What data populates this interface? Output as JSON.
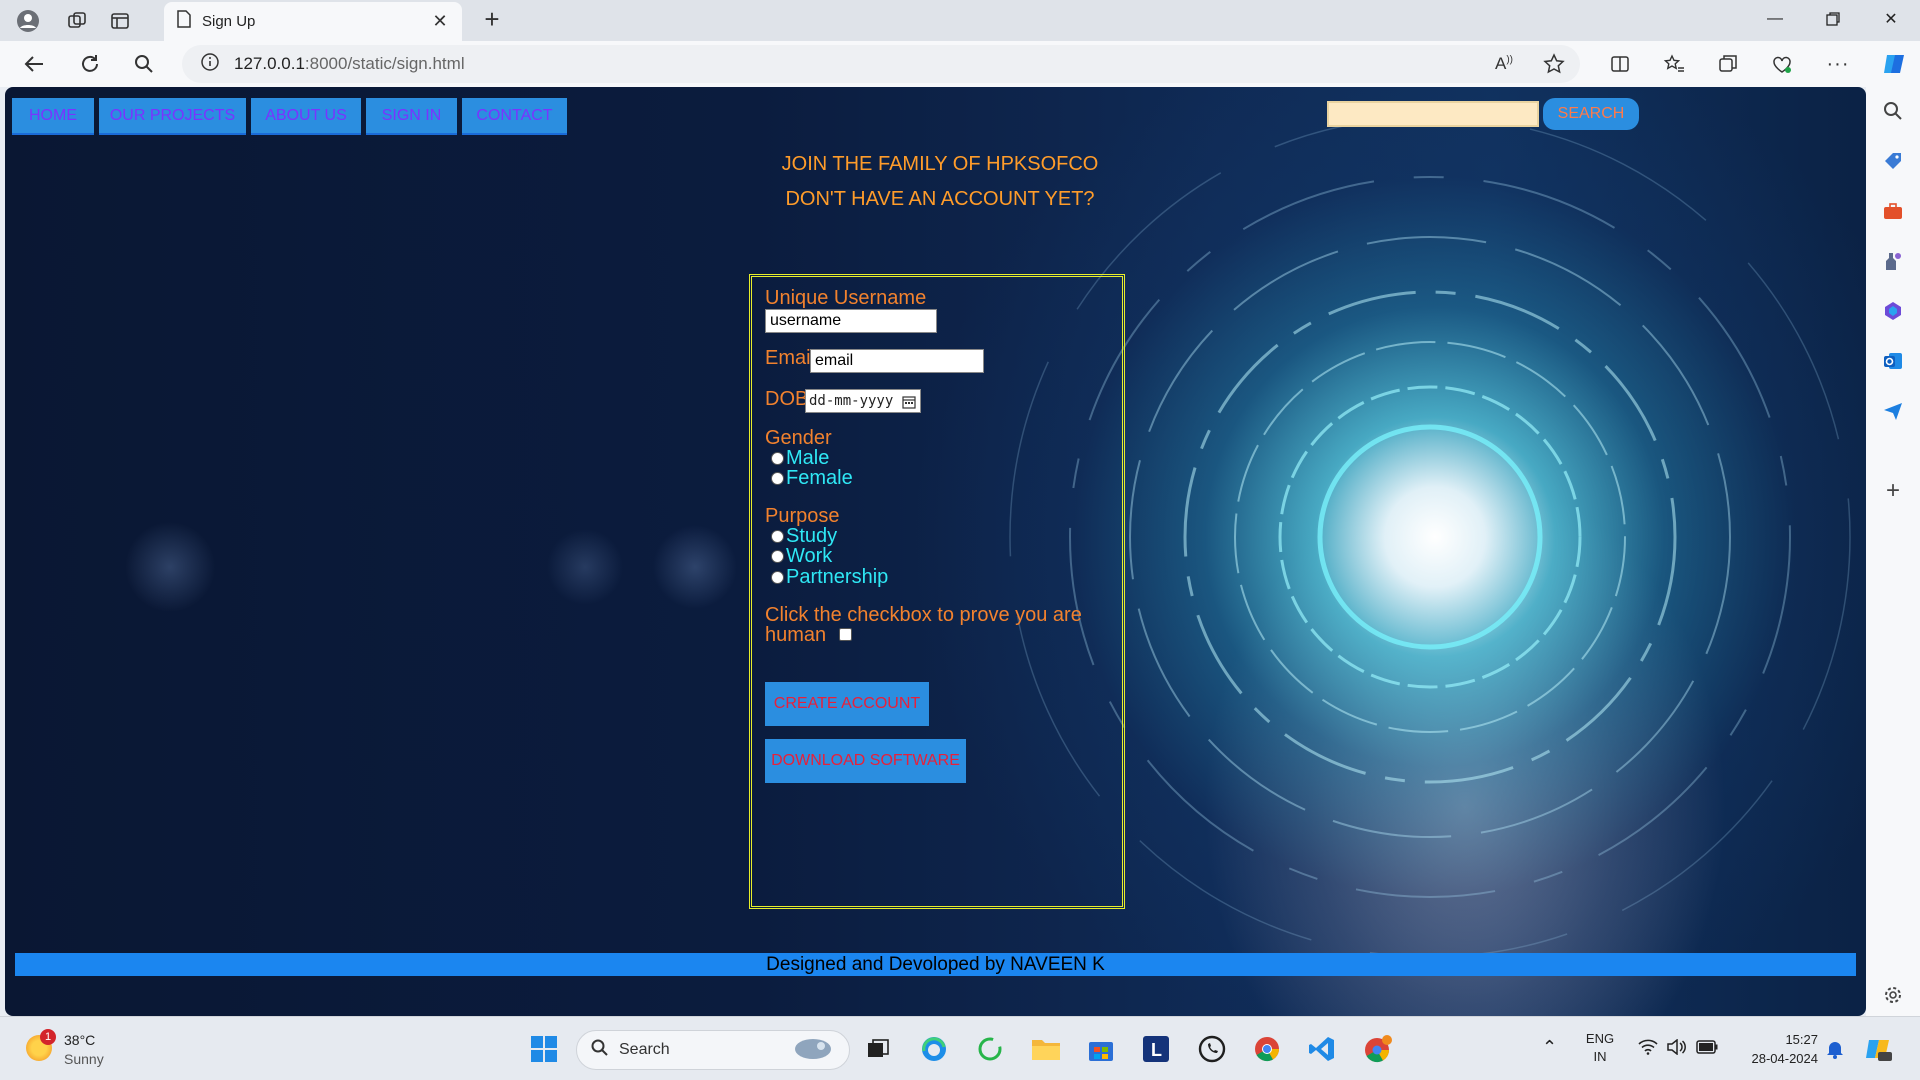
{
  "browser": {
    "tab_title": "Sign Up",
    "url_host": "127.0.0.1",
    "url_rest": ":8000/static/sign.html"
  },
  "nav": {
    "items": [
      "HOME",
      "OUR PROJECTS",
      "ABOUT US",
      "SIGN IN",
      "CONTACT"
    ],
    "search_value": "",
    "search_button": "SEARCH"
  },
  "headings": {
    "join": "JOIN THE FAMILY OF HPKSOFCO",
    "no_account": "DON'T HAVE AN ACCOUNT YET?"
  },
  "form": {
    "username_label": "Unique Username",
    "username_value": "username",
    "email_label": "Email",
    "email_value": "email",
    "dob_label": "DOB",
    "dob_placeholder": "dd-mm-yyyy",
    "gender_label": "Gender",
    "gender_options": [
      "Male",
      "Female"
    ],
    "purpose_label": "Purpose",
    "purpose_options": [
      "Study",
      "Work",
      "Partnership"
    ],
    "human_line1": "Click the checkbox to prove you are",
    "human_line2": "human",
    "create_button": "CREATE ACCOUNT",
    "download_button": "DOWNLOAD SOFTWARE"
  },
  "footer": {
    "text": "Designed and Devoloped by NAVEEN K"
  },
  "taskbar": {
    "weather_temp": "38°C",
    "weather_desc": "Sunny",
    "weather_badge": "1",
    "search_label": "Search",
    "lang1": "ENG",
    "lang2": "IN",
    "time": "15:27",
    "date": "28-04-2024"
  },
  "colors": {
    "nav_bg": "#2b8ee0",
    "nav_text": "#7a33ff",
    "label_orange": "#f2822e",
    "option_cyan": "#2fe8f5",
    "form_border": "#e7ee2b",
    "button_text_red": "#e8203a",
    "footer_bg": "#1b86f0"
  }
}
